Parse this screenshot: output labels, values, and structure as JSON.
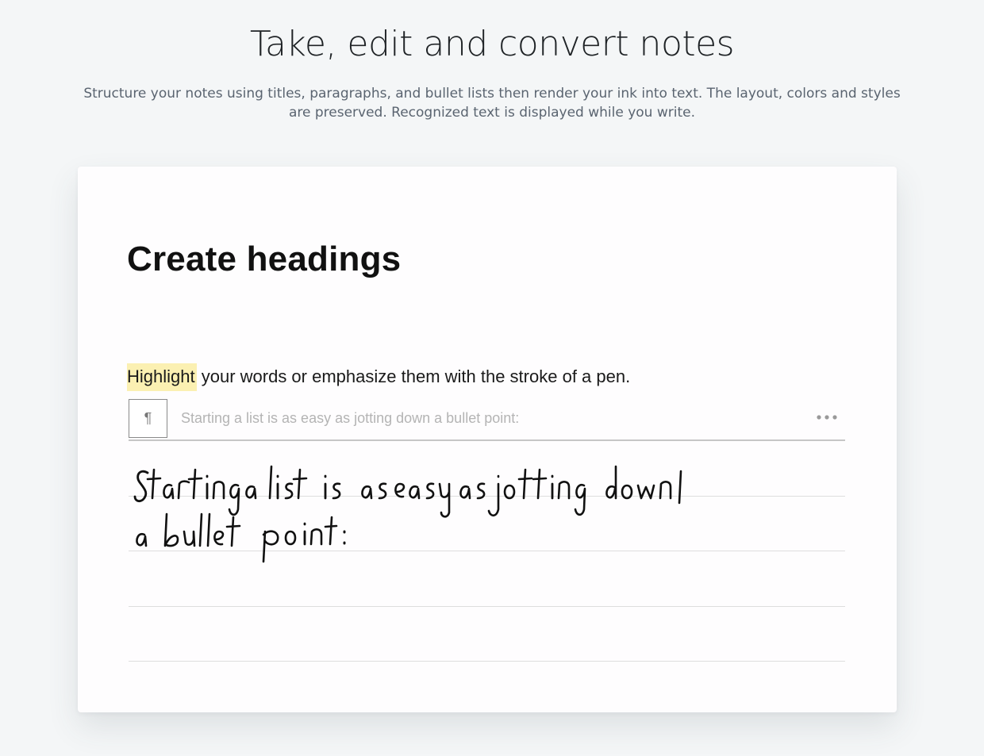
{
  "hero": {
    "title": "Take, edit and convert notes",
    "subtitle": "Structure your notes using titles, paragraphs, and bullet lists then render your ink into text. The layout, colors and styles are preserved. Recognized text is displayed while you write."
  },
  "editor": {
    "heading": "Create headings",
    "paragraph": {
      "highlighted_word": "Highlight",
      "rest": " your words or emphasize them with the stroke of a pen."
    },
    "toolbar": {
      "paragraph_symbol": "¶",
      "recognized_text": "Starting a list is as easy as jotting down a bullet point:",
      "more_icon": "ellipsis-icon"
    },
    "ink": {
      "line1": "Starting a list is as easy as jotting down",
      "line2": "a bullet point:"
    },
    "colors": {
      "highlight": "#fbf0b2",
      "ink": "#111111"
    }
  }
}
